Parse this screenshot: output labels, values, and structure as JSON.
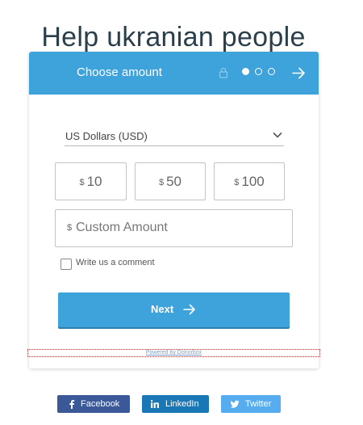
{
  "page": {
    "title": "Help ukranian people"
  },
  "header": {
    "title": "Choose amount",
    "icons": [
      "lock-icon",
      "step-dot-icon",
      "arrow-right-icon"
    ],
    "accent_color": "#3ea2db"
  },
  "currency": {
    "selected": "US Dollars (USD)"
  },
  "amounts": [
    {
      "currency": "$",
      "value": "10"
    },
    {
      "currency": "$",
      "value": "50"
    },
    {
      "currency": "$",
      "value": "100"
    }
  ],
  "custom_amount": {
    "currency": "$",
    "placeholder": "Custom Amount"
  },
  "comment": {
    "label": "Write us a comment",
    "checked": false
  },
  "next_button": {
    "label": "Next"
  },
  "powered_by": "Powered by Donorbox",
  "share": [
    {
      "label": "Facebook",
      "icon": "facebook-icon",
      "color": "#3b5998"
    },
    {
      "label": "LinkedIn",
      "icon": "linkedin-icon",
      "color": "#1a77b5"
    },
    {
      "label": "Twitter",
      "icon": "twitter-icon",
      "color": "#55acee"
    }
  ]
}
